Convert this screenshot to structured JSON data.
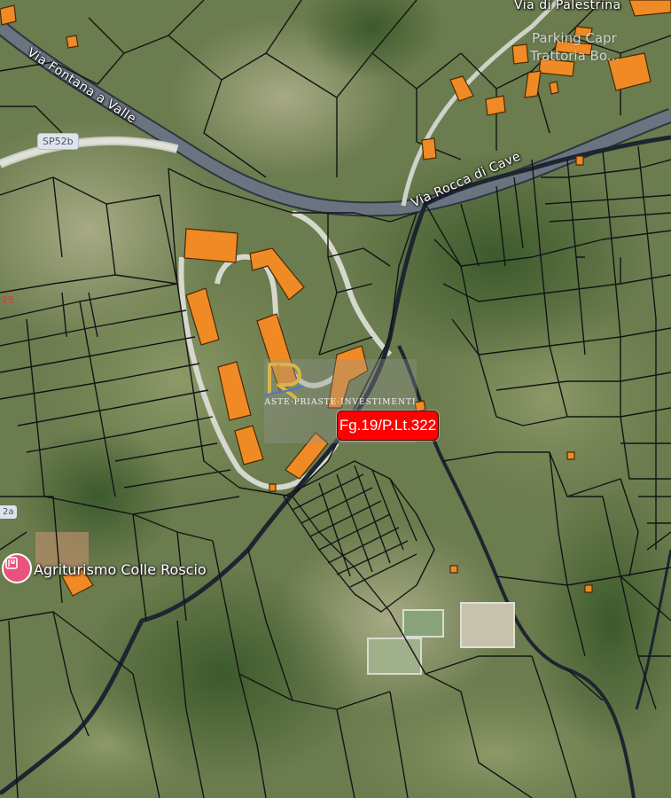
{
  "map": {
    "basemap": "satellite",
    "colors": {
      "field_light": "#9aa57a",
      "forest_dark": "#3f5a2f",
      "parcel_line": "#141414",
      "building_fill": "#f08a24",
      "building_stroke": "#4a2a05",
      "road_fill": "#6a7480",
      "stream": "#1d2530",
      "highlight": "#ff0000"
    },
    "road_labels": {
      "palestrina": "Via di Palestrina",
      "fontana": "Via Fontana a Valle",
      "rocca": "Via Rocca di Cave"
    },
    "shields": {
      "sp52b": "SP52b",
      "left_edge": "2a"
    },
    "edge_number": "25",
    "poi": {
      "name": "Agriturismo Colle Roscio",
      "icon": "restaurant-icon"
    },
    "faded_labels": {
      "parking": "Parking Capr",
      "trattoria": "Trattoria Bo..."
    },
    "parcel_label": "Fg.19/P.Lt.322",
    "watermark": {
      "text": "ASTE·PRIASTE·INVESTIMENTI",
      "icon": "logo-icon"
    }
  }
}
